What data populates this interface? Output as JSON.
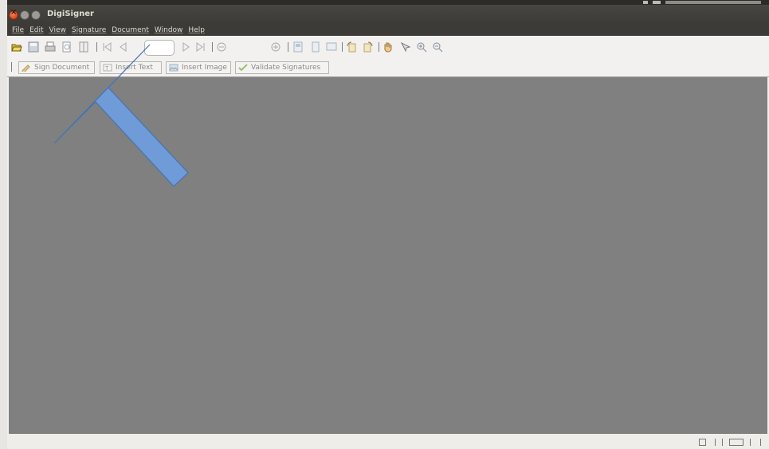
{
  "window": {
    "title": "DigiSigner"
  },
  "menu": [
    "File",
    "Edit",
    "View",
    "Signature",
    "Document",
    "Window",
    "Help"
  ],
  "toolbar": {
    "icons": [
      "open-icon",
      "save-icon",
      "print-icon",
      "preview-icon",
      "document-properties-icon",
      "first-page-icon",
      "previous-page-icon",
      "next-page-icon",
      "last-page-icon",
      "zoom-out-icon",
      "zoom-in-icon",
      "page-layout-icon",
      "single-page-icon",
      "facing-pages-icon",
      "rotate-left-icon",
      "rotate-right-icon",
      "hand-tool-icon",
      "select-tool-icon",
      "zoom-in-magnifier-icon",
      "zoom-out-magnifier-icon"
    ],
    "page_value": ""
  },
  "actions": {
    "sign_document": "Sign Document",
    "insert_text": "Insert Text",
    "insert_image": "Insert Image",
    "validate_signatures": "Validate Signatures"
  },
  "annotation": {
    "type": "arrow",
    "color": "#6699dd"
  },
  "colors": {
    "canvas": "#808080",
    "titlebar": "#3c3b37",
    "close": "#e2572b"
  }
}
